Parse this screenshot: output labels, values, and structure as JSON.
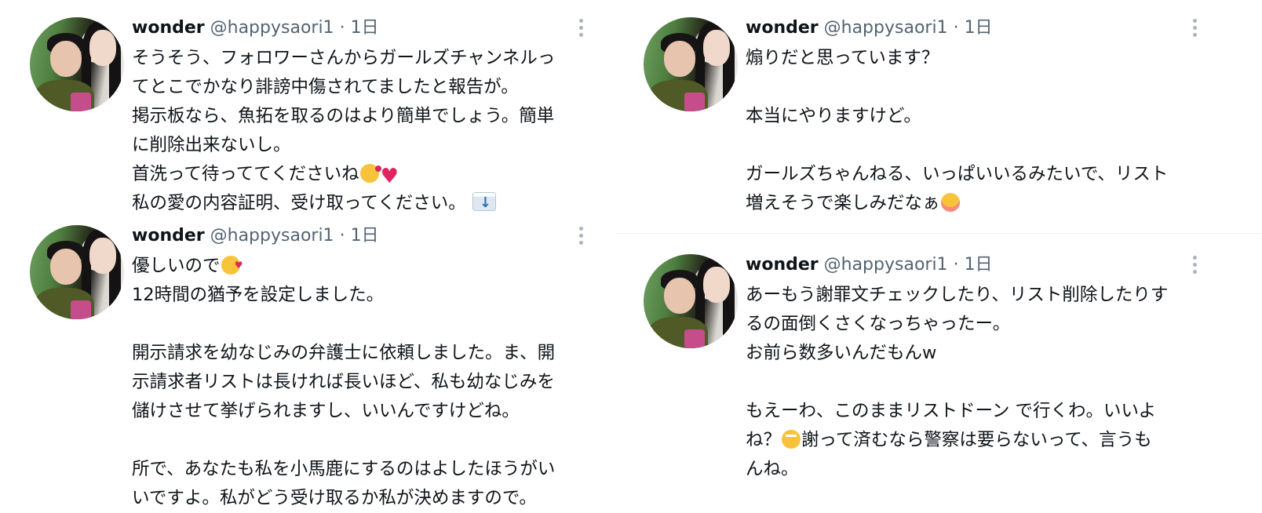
{
  "tweets": [
    {
      "name": "wonder",
      "handle": "@happysaori1",
      "dot": "·",
      "time": "1日",
      "lines": [
        "そうそう、フォロワーさんからガールズチャンネルっ",
        "てとこでかなり誹謗中傷されてましたと報告が。",
        "掲示板なら、魚拓を取るのはより簡単でしょう。簡単",
        "に削除出来ないし。",
        "首洗って待っててくださいね",
        "私の愛の内容証明、受け取ってください。"
      ],
      "emojis": [
        "kiss-emoji",
        "heart-emoji",
        "envelope-emoji"
      ]
    },
    {
      "name": "wonder",
      "handle": "@happysaori1",
      "dot": "·",
      "time": "1日",
      "lines": [
        "優しいので",
        "12時間の猶予を設定しました。",
        "",
        "開示請求を幼なじみの弁護士に依頼しました。ま、開",
        "示請求者リストは長ければ長いほど、私も幼なじみを",
        "儲けさせて挙げられますし、いいんですけどね。",
        "",
        "所で、あなたも私を小馬鹿にするのはよしたほうがい",
        "いですよ。私がどう受け取るか私が決めますので。"
      ],
      "emojis": [
        "smiling-face-with-hearts-emoji"
      ]
    },
    {
      "name": "wonder",
      "handle": "@happysaori1",
      "dot": "·",
      "time": "1日",
      "lines": [
        "煽りだと思っています？",
        "",
        "本当にやりますけど。",
        "",
        "ガールズちゃんねる、いっぱいいるみたいで、リスト",
        "増えそうで楽しみだなぁ"
      ],
      "emojis": [
        "relieved-face-emoji"
      ]
    },
    {
      "name": "wonder",
      "handle": "@happysaori1",
      "dot": "·",
      "time": "1日",
      "lines": [
        "あーもう謝罪文チェックしたり、リスト削除したりす",
        "るの面倒くさくなっちゃったー。",
        "お前ら数多いんだもんw",
        "",
        "もえーわ、このままリストドーン で行くわ。いいよ",
        "ね？",
        "謝って済むなら警察は要らないって、言うも",
        "んね。"
      ],
      "emojis": [
        "face-with-rolling-eyes-emoji"
      ]
    }
  ],
  "colors": {
    "text": "#0f1419",
    "secondary": "#536471",
    "divider": "#eff3f4"
  }
}
